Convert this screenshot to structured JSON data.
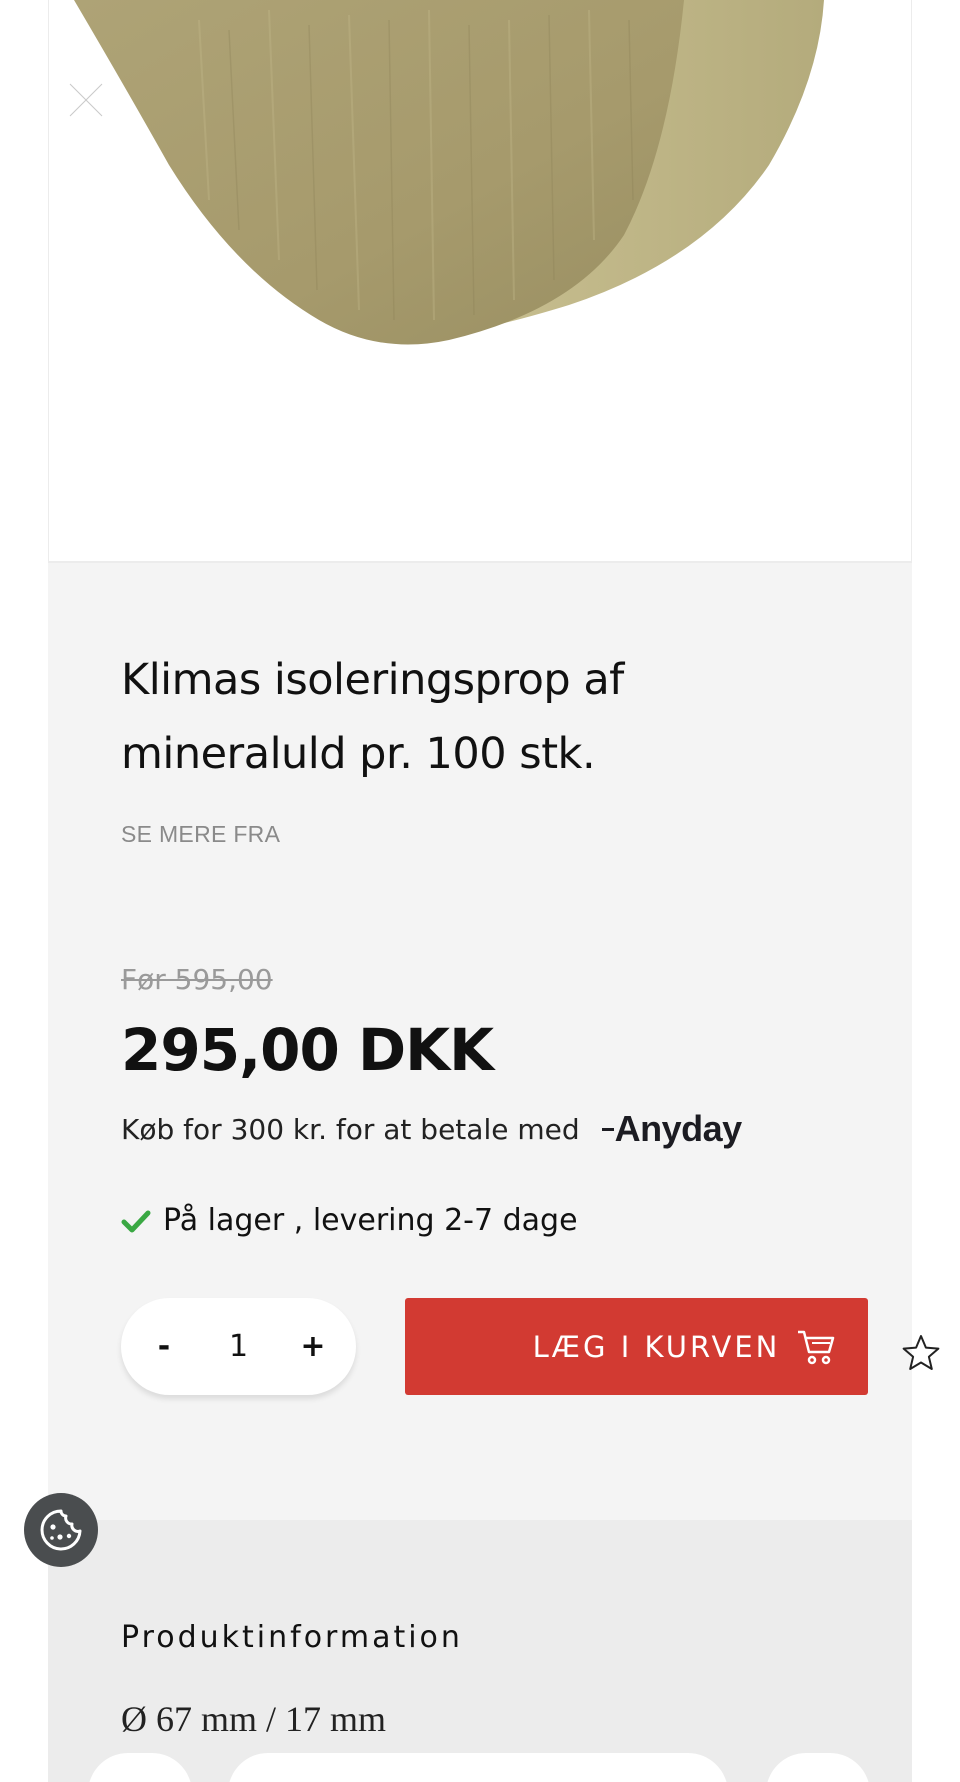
{
  "product": {
    "title": "Klimas isoleringsprop af mineraluld pr. 100 stk.",
    "see_more_label": "SE MERE FRA",
    "old_price": "Før 595,00",
    "price": "295,00 DKK",
    "anyday_text": "Køb for 300 kr. for at betale med",
    "anyday_logo": "Anyday",
    "stock_text": "På lager , levering 2-7 dage"
  },
  "cart": {
    "decrement_label": "-",
    "quantity": "1",
    "increment_label": "+",
    "add_label": "LÆG I KURVEN"
  },
  "product_info": {
    "title": "Produktinformation",
    "dimensions": "Ø 67 mm / 17 mm"
  },
  "icons": {
    "close": "close-icon",
    "check": "check-icon",
    "cart": "cart-icon",
    "star": "star-outline-icon",
    "cookie": "cookie-icon"
  },
  "colors": {
    "accent": "#d23a32",
    "stock_green": "#3aa843",
    "panel_bg": "#f4f4f4",
    "info_bg": "#ececec",
    "cookie_bg": "#4a4d4f"
  }
}
